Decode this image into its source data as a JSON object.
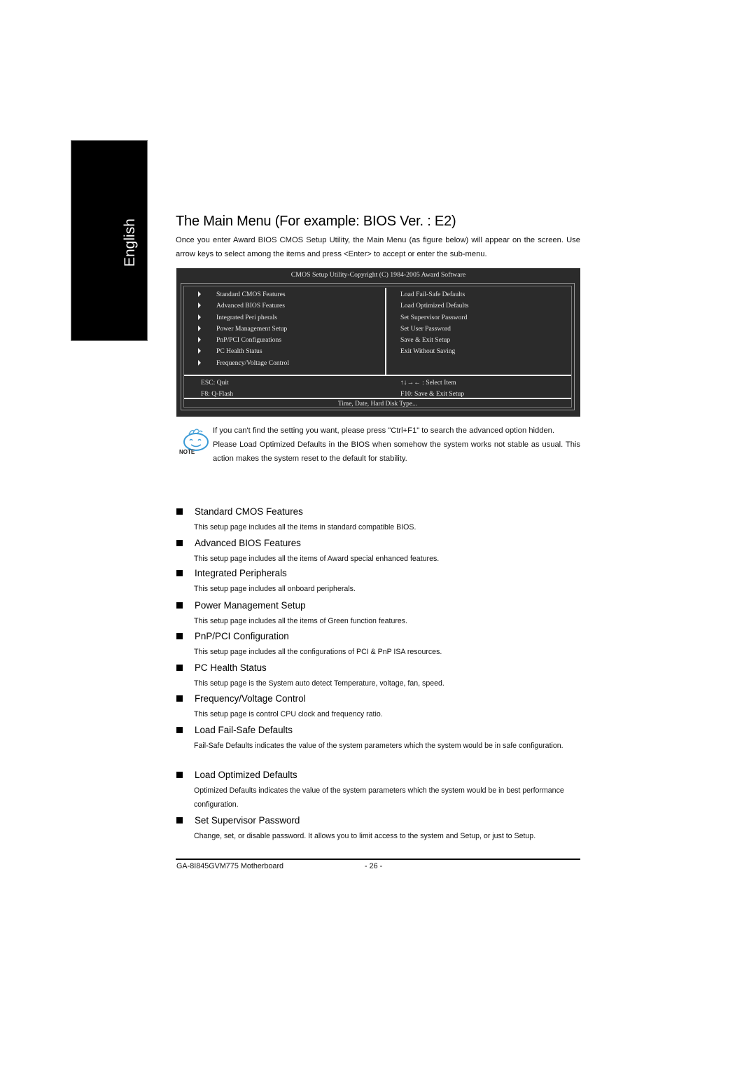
{
  "sidebar": {
    "language_tab": "English"
  },
  "page": {
    "title": "The Main Menu (For example: BIOS Ver. : E2)",
    "intro": "Once you enter Award BIOS CMOS Setup Utility, the Main Menu (as figure below) will appear on the screen. Use arrow keys to select among the items and press <Enter> to accept or enter the sub-menu."
  },
  "bios": {
    "title": "CMOS Setup Utility-Copyright (C) 1984-2005 Award Software",
    "left_items": [
      "Standard CMOS Features",
      "Advanced BIOS Features",
      "Integrated Peri pherals",
      "Power Management Setup",
      "PnP/PCI Configurations",
      "PC Health Status",
      "Frequency/Voltage Control"
    ],
    "right_items": [
      "Load Fail-Safe Defaults",
      "Load Optimized Defaults",
      "Set Supervisor Password",
      "Set User Password",
      "Save & Exit Setup",
      "Exit Without Saving"
    ],
    "help_left": [
      "ESC: Quit",
      "F8: Q-Flash"
    ],
    "help_right": [
      "↑↓→← : Select Item",
      "F10: Save & Exit Setup"
    ],
    "status": "Time, Date, Hard Disk Type..."
  },
  "note": {
    "icon_label": "NOTE",
    "lines": [
      "If you can't find the setting you want, please press \"Ctrl+F1\" to search the advanced option hidden.",
      "Please Load Optimized Defaults in the BIOS when somehow the system works not stable as usual. This action makes the system reset to the default for stability."
    ]
  },
  "sections": [
    {
      "heading": "Standard CMOS Features",
      "description": "This setup page includes all the items in standard compatible BIOS."
    },
    {
      "heading": "Advanced BIOS Features",
      "description": "This setup page includes all the items of Award special enhanced features."
    },
    {
      "heading": "Integrated Peripherals",
      "description": "This setup page includes all onboard peripherals."
    },
    {
      "heading": "Power Management Setup",
      "description": "This setup page includes all the items of Green function features."
    },
    {
      "heading": "PnP/PCI Configuration",
      "description": "This setup page includes all the configurations of PCI & PnP ISA resources."
    },
    {
      "heading": "PC Health Status",
      "description": "This setup page is the System auto detect Temperature, voltage, fan, speed."
    },
    {
      "heading": "Frequency/Voltage Control",
      "description": "This setup page is control CPU clock and frequency ratio."
    },
    {
      "heading": "Load Fail-Safe Defaults",
      "description": "Fail-Safe Defaults indicates the value of the system parameters which the system would be in safe configuration."
    },
    {
      "heading": "Load Optimized Defaults",
      "description": "Optimized Defaults indicates the value of the system parameters which the system would be in best performance configuration."
    },
    {
      "heading": "Set Supervisor Password",
      "description": "Change, set, or disable password. It allows you to limit access to the system and Setup, or just to Setup."
    }
  ],
  "footer": {
    "model": "GA-8I845GVM775 Motherboard",
    "page_number": "- 26 -"
  }
}
